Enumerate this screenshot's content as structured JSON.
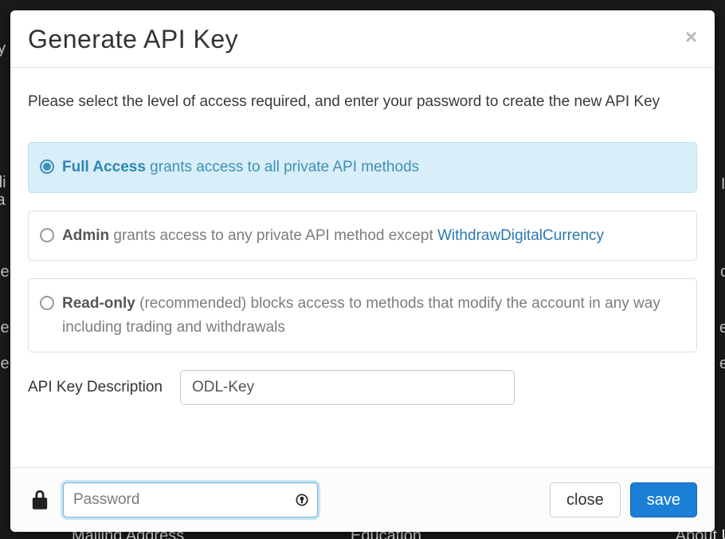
{
  "modal": {
    "title": "Generate API Key",
    "instruction": "Please select the level of access required, and enter your password to create the new API Key",
    "options": {
      "full": {
        "name": "Full Access",
        "desc": " grants access to all private API methods",
        "selected": true
      },
      "admin": {
        "name": "Admin",
        "desc": " grants access to any private API method except ",
        "link": "WithdrawDigitalCurrency",
        "selected": false
      },
      "readonly": {
        "name": "Read-only",
        "hint": " (recommended)",
        "desc": " blocks access to methods that modify the account in any way including trading and withdrawals",
        "selected": false
      }
    },
    "desc_label": "API Key Description",
    "desc_value": "ODL-Key",
    "password_placeholder": "Password",
    "close_label": "close",
    "save_label": "save"
  },
  "background": {
    "items": [
      "ey",
      "di",
      "ta",
      "De",
      "De",
      "De",
      "II",
      "c",
      "e",
      "e",
      "Mailing Address",
      "Education",
      "About Us"
    ]
  }
}
